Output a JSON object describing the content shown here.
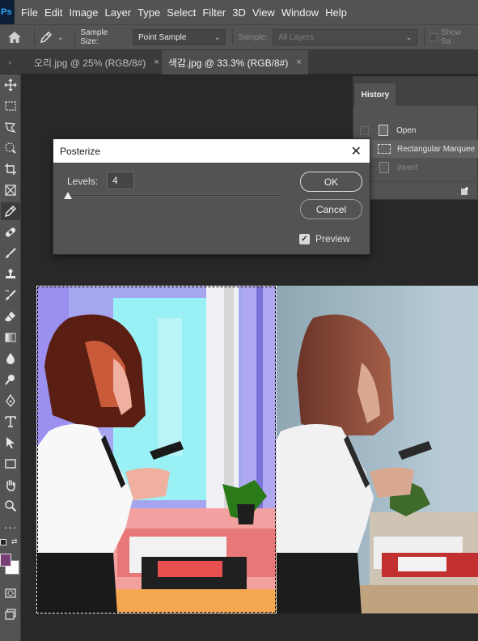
{
  "app": {
    "logo": "Ps"
  },
  "menu": [
    "File",
    "Edit",
    "Image",
    "Layer",
    "Type",
    "Select",
    "Filter",
    "3D",
    "View",
    "Window",
    "Help"
  ],
  "options": {
    "sample_size_label": "Sample Size:",
    "sample_size_value": "Point Sample",
    "sample_label": "Sample:",
    "sample_value": "All Layers",
    "show_sampling_label": "Show Sa"
  },
  "tabs": [
    {
      "label": "오리.jpg @ 25% (RGB/8#)",
      "close": "×"
    },
    {
      "label": "색감.jpg @ 33.3% (RGB/8#)",
      "close": "×"
    }
  ],
  "history": {
    "title": "History",
    "items": [
      {
        "label": "Open"
      },
      {
        "label": "Rectangular Marquee"
      },
      {
        "label": "Invert"
      }
    ]
  },
  "dialog": {
    "title": "Posterize",
    "close": "✕",
    "levels_label": "Levels:",
    "levels_value": "4",
    "ok_label": "OK",
    "cancel_label": "Cancel",
    "preview_label": "Preview",
    "preview_checked": true
  },
  "colors": {
    "foreground": "#7b3f78",
    "background": "#ffffff",
    "ui_panel": "#535353",
    "canvas_bg": "#282828"
  }
}
